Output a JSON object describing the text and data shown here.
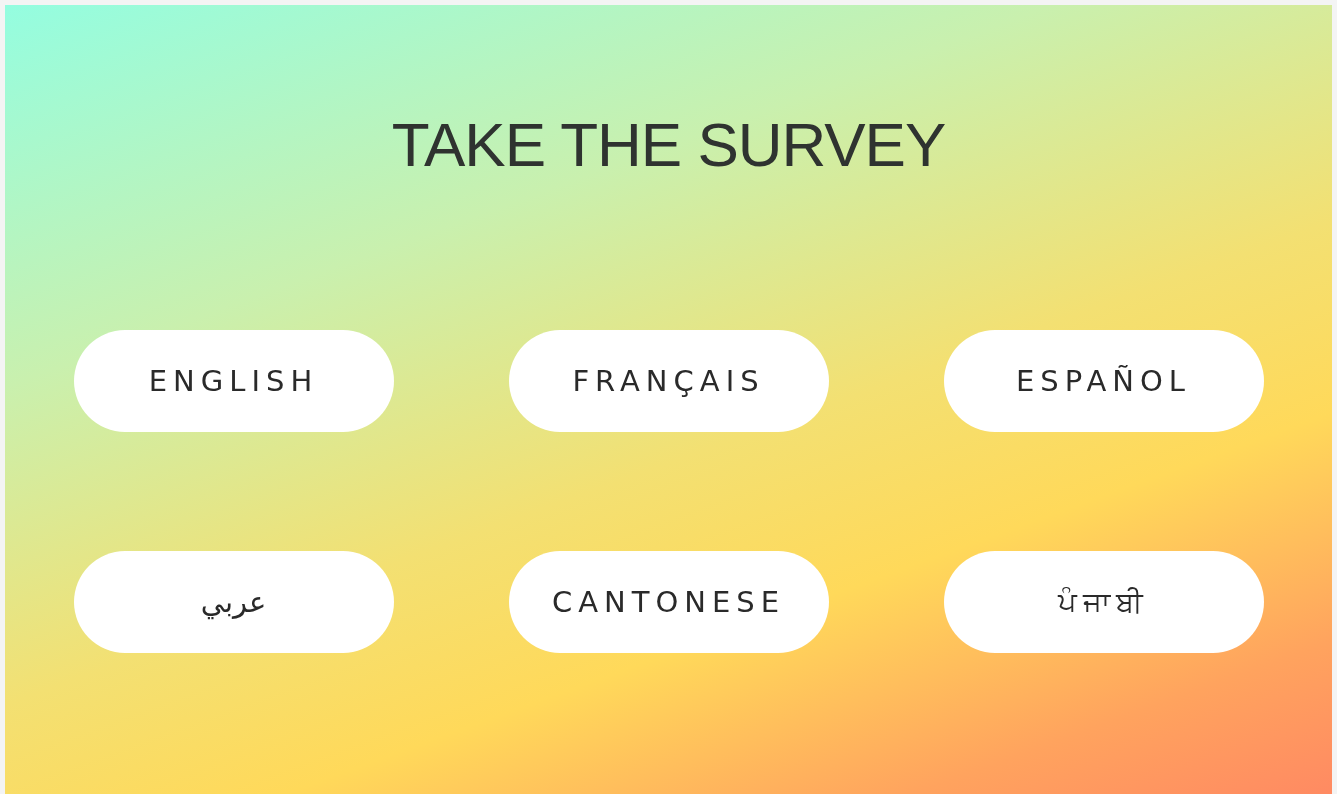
{
  "title": "TAKE THE SURVEY",
  "languages": [
    {
      "label": "ENGLISH"
    },
    {
      "label": "FRANÇAIS"
    },
    {
      "label": "ESPAÑOL"
    },
    {
      "label": "عربي"
    },
    {
      "label": "CANTONESE"
    },
    {
      "label": "ਪੰਜਾਬੀ"
    }
  ]
}
